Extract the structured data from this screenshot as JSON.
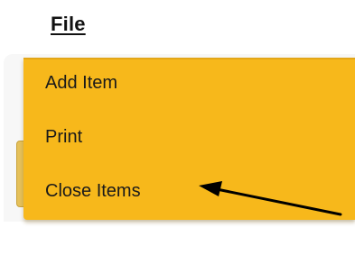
{
  "file_menu": {
    "title": "File",
    "items": [
      {
        "label": "Add Item"
      },
      {
        "label": "Print"
      },
      {
        "label": "Close Items"
      }
    ]
  },
  "annotation": {
    "icon": "arrow-icon",
    "points_to": "Close Items"
  },
  "colors": {
    "menu_background": "#f7b81b",
    "menu_text": "#1a1a1a",
    "arrow": "#000000"
  }
}
